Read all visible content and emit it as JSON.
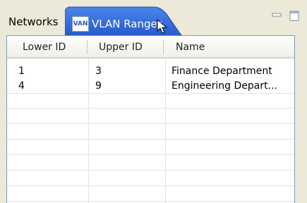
{
  "tabs": {
    "networks_label": "Networks",
    "vlan_label": "VLAN Ranges",
    "vlan_icon_text": "VAN",
    "vlan_icon": "vlan-icon"
  },
  "window_controls": {
    "minimize_icon": "minimize-icon",
    "maximize_icon": "maximize-icon"
  },
  "table": {
    "columns": [
      "Lower ID",
      "Upper ID",
      "Name"
    ],
    "rows": [
      [
        "1",
        "3",
        "Finance  Department"
      ],
      [
        "4",
        "9",
        "Engineering Depart..."
      ]
    ]
  },
  "colors": {
    "active_tab": "#2f64d6",
    "background": "#ece9d8",
    "border": "#7f9db9"
  }
}
